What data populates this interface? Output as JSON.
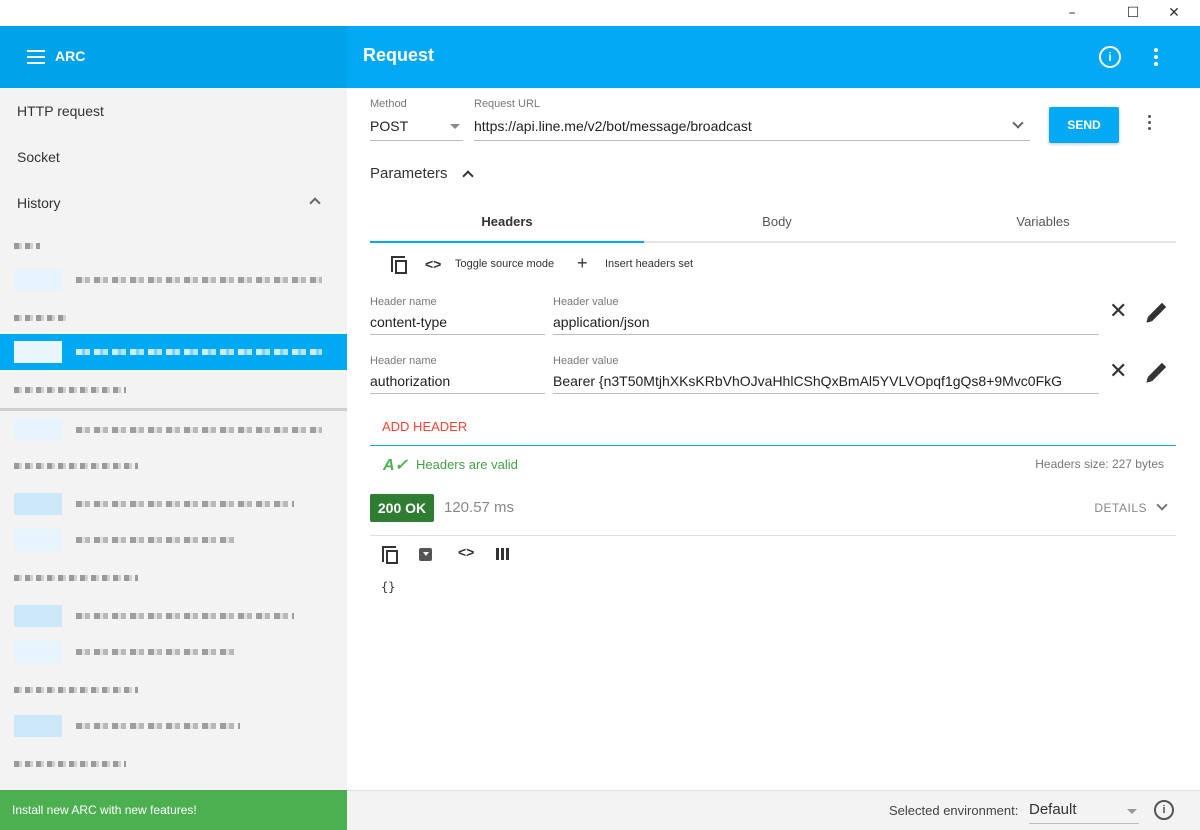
{
  "window": {
    "minimize": "–",
    "maximize": "☐",
    "close": "✕"
  },
  "appbar": {
    "app_name": "ARC",
    "title": "Request",
    "info_icon": "info-icon",
    "menu_icon": "menu-icon"
  },
  "sidebar": {
    "items": [
      {
        "label": "HTTP request"
      },
      {
        "label": "Socket"
      },
      {
        "label": "History"
      }
    ]
  },
  "install_banner": "Install new ARC with new features!",
  "request": {
    "method_label": "Method",
    "method": "POST",
    "url_label": "Request URL",
    "url": "https://api.line.me/v2/bot/message/broadcast",
    "send_label": "SEND",
    "parameters_label": "Parameters"
  },
  "tabs": [
    {
      "label": "Headers",
      "active": true
    },
    {
      "label": "Body"
    },
    {
      "label": "Variables"
    }
  ],
  "toolbar": {
    "toggle_source": "Toggle source mode",
    "insert_set": "Insert headers set"
  },
  "headers": [
    {
      "name_label": "Header name",
      "name": "content-type",
      "value_label": "Header value",
      "value": "application/json"
    },
    {
      "name_label": "Header name",
      "name": "authorization",
      "value_label": "Header value",
      "value": "Bearer {n3T50MtjhXKsKRbVhOJvaHhlCShQxBmAl5YVLVOpqf1gQs8+9Mvc0FkG"
    }
  ],
  "add_header_label": "ADD HEADER",
  "validation": {
    "text": "Headers are valid",
    "size": "Headers size: 227 bytes"
  },
  "response": {
    "status": "200 OK",
    "time": "120.57 ms",
    "details_label": "DETAILS",
    "body": "{}"
  },
  "footer": {
    "env_label": "Selected environment:",
    "env_value": "Default",
    "info": "i"
  },
  "colors": {
    "primary": "#03a9f4",
    "success": "#2e7d32",
    "danger": "#f44336",
    "banner": "#4caf50"
  }
}
